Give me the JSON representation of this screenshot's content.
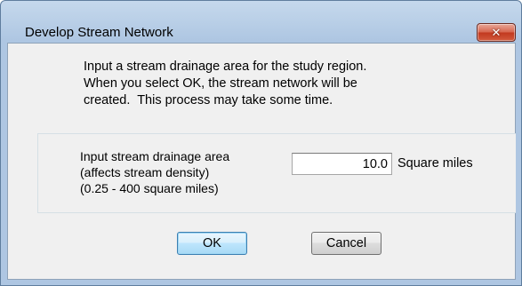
{
  "window": {
    "title": "Develop Stream Network",
    "close_label": "✕"
  },
  "intro_text": "Input a stream drainage area for the study region.\nWhen you select OK, the stream network will be\ncreated.  This process may take some time.",
  "drainage": {
    "label": "Input stream drainage area\n(affects stream density)\n(0.25 - 400 square miles)",
    "value": "10.0",
    "units": "Square miles"
  },
  "buttons": {
    "ok": "OK",
    "cancel": "Cancel"
  }
}
